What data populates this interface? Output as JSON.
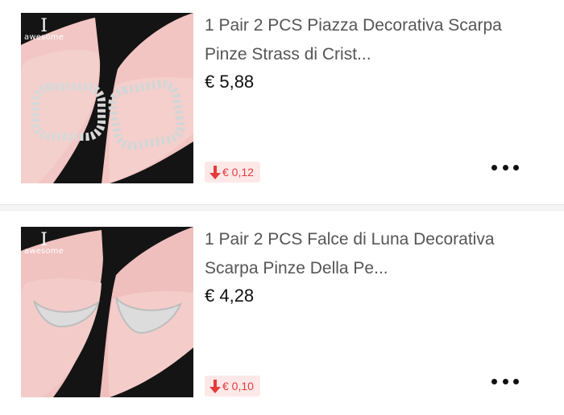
{
  "products": [
    {
      "title": "1 Pair 2 PCS Piazza Decorativa Scarpa Pinze Strass di Crist...",
      "price": "€ 5,88",
      "price_drop": "€ 0,12",
      "brand_mark": "I",
      "brand_text": "awesome",
      "icons": {
        "drop": "arrow-down-icon",
        "more": "more-dots-icon"
      }
    },
    {
      "title": "1 Pair 2 PCS Falce di Luna Decorativa Scarpa Pinze Della Pe...",
      "price": "€ 4,28",
      "price_drop": "€ 0,10",
      "brand_mark": "I",
      "brand_text": "awesome",
      "icons": {
        "drop": "arrow-down-icon",
        "more": "more-dots-icon"
      }
    }
  ],
  "colors": {
    "price_drop_text": "#e43a3a",
    "price_drop_bg": "#fde8e8",
    "shoe_pink": "#f2c4c4",
    "image_bg": "#121212"
  }
}
